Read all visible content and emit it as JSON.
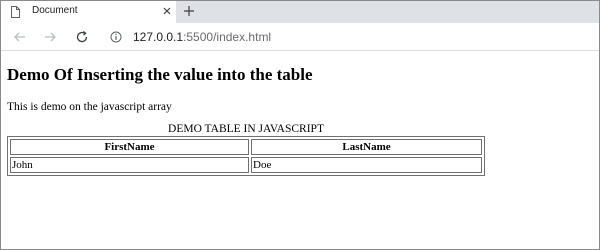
{
  "browser": {
    "tab_title": "Document",
    "url_host": "127.0.0.1",
    "url_rest": ":5500/index.html",
    "icons": {
      "tab": "document-icon",
      "close": "close-icon",
      "new_tab": "plus-icon",
      "back": "arrow-left-icon",
      "forward": "arrow-right-icon",
      "reload": "reload-icon",
      "site_info": "info-icon"
    }
  },
  "page": {
    "heading": "Demo Of Inserting the value into the table",
    "paragraph": "This is demo on the javascript array",
    "table": {
      "caption": "DEMO TABLE IN JAVASCRIPT",
      "headers": [
        "FirstName",
        "LastName"
      ],
      "rows": [
        [
          "John",
          "Doe"
        ]
      ]
    }
  }
}
